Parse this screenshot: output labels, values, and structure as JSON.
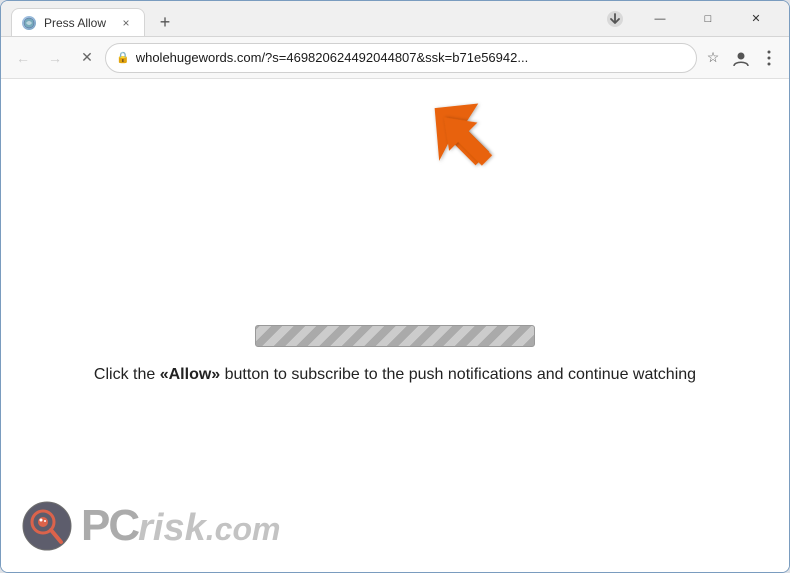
{
  "window": {
    "title": "Press Allow",
    "url": "wholehugewords.com/?s=469820624492044807&ssk=b71e56942...",
    "url_full": "wholehugewords.com/?s=469820624492044807&ssk=b71e56942..."
  },
  "toolbar": {
    "new_tab_label": "+",
    "back_label": "←",
    "forward_label": "→",
    "reload_label": "✕",
    "lock_icon": "🔒"
  },
  "controls": {
    "minimize": "—",
    "maximize": "□",
    "close": "✕"
  },
  "tab": {
    "title": "Press Allow",
    "close": "×"
  },
  "page": {
    "message": "Click the «Allow» button to subscribe to the push notifications and continue watching",
    "message_part1": "Click the ",
    "message_allow": "«Allow»",
    "message_part2": " button to subscribe to the push notifications and continue watching"
  },
  "watermark": {
    "text_pc": "PC",
    "text_risk": "risk",
    "text_com": ".com"
  },
  "icons": {
    "star": "☆",
    "profile": "👤",
    "menu": "⋮",
    "extensions_label": "extensions"
  }
}
